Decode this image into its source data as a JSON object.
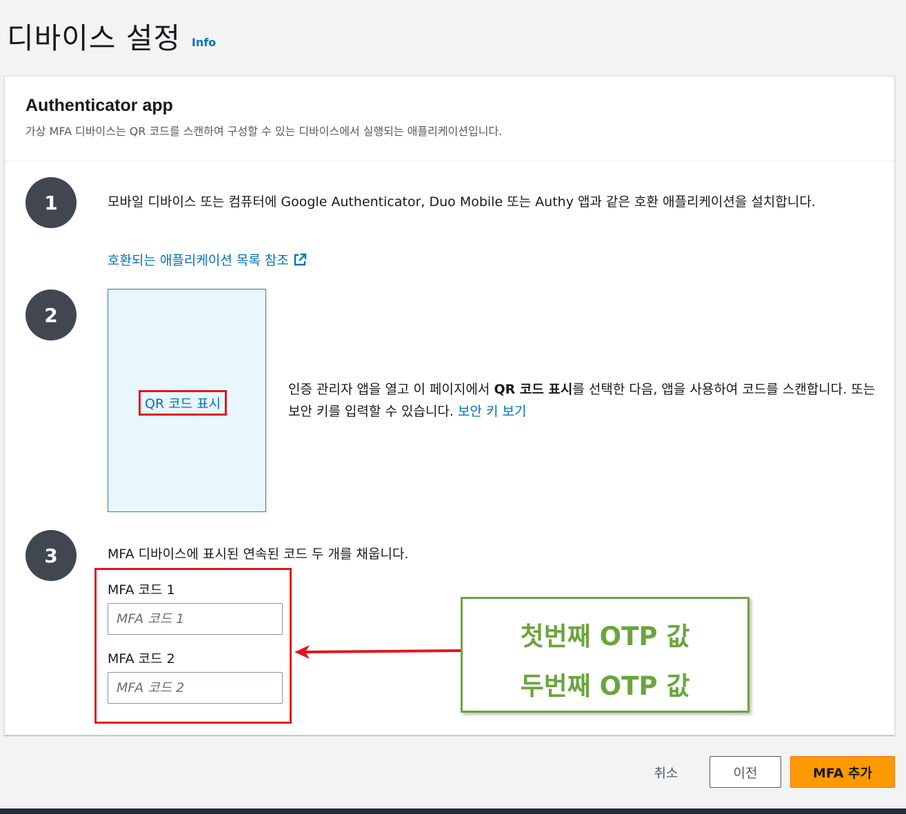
{
  "header": {
    "title": "디바이스 설정",
    "info": "Info"
  },
  "panel": {
    "title": "Authenticator app",
    "description": "가상 MFA 디바이스는 QR 코드를 스캔하여 구성할 수 있는 디바이스에서 실행되는 애플리케이션입니다."
  },
  "steps": {
    "step1": {
      "number": "1",
      "text": "모바일 디바이스 또는 컴퓨터에 Google Authenticator, Duo Mobile 또는 Authy 앱과 같은 호환 애플리케이션을 설치합니다.",
      "link": "호환되는 애플리케이션 목록 참조"
    },
    "step2": {
      "number": "2",
      "qr_link": "QR 코드 표시",
      "text_before": "인증 관리자 앱을 열고 이 페이지에서 ",
      "text_bold": "QR 코드 표시",
      "text_after": "를 선택한 다음, 앱을 사용하여 코드를 스캔합니다. 또는 보안 키를 입력할 수 있습니다. ",
      "link": "보안 키 보기"
    },
    "step3": {
      "number": "3",
      "text": "MFA 디바이스에 표시된 연속된 코드 두 개를 채웁니다.",
      "code1_label": "MFA 코드 1",
      "code1_placeholder": "MFA 코드 1",
      "code2_label": "MFA 코드 2",
      "code2_placeholder": "MFA 코드 2"
    }
  },
  "annotation": {
    "line1": "첫번째 OTP 값",
    "line2": "두번째 OTP 값"
  },
  "footer": {
    "cancel": "취소",
    "previous": "이전",
    "add_mfa": "MFA 추가"
  },
  "icons": {
    "external": "external-link-icon",
    "arrow": "arrow-left-icon"
  },
  "colors": {
    "accent": "#ff9900",
    "link": "#0073bb",
    "highlight_red": "#e0161d",
    "annotation_green": "#6aa53d"
  }
}
